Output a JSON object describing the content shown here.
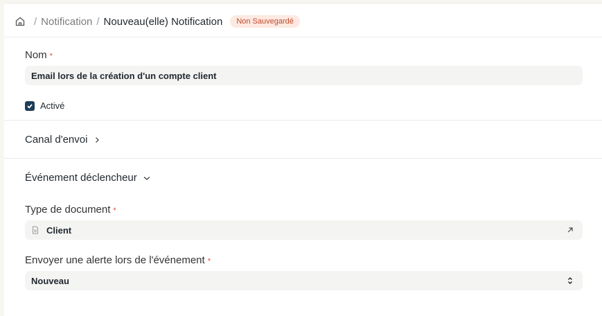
{
  "breadcrumb": {
    "home_icon": "home-icon",
    "items": [
      "Notification",
      "Nouveau(elle) Notification"
    ],
    "separator": "/",
    "status_badge": "Non Sauvegardé"
  },
  "form": {
    "nom": {
      "label": "Nom",
      "required_mark": "*",
      "value": "Email lors de la création d'un compte client"
    },
    "active": {
      "label": "Activé",
      "checked": true
    },
    "channel_section": {
      "title": "Canal d'envoi",
      "icon": "chevron-right-icon"
    },
    "trigger_section": {
      "title": "Événement déclencheur",
      "icon": "chevron-down-icon"
    },
    "document_type": {
      "label": "Type de document",
      "required_mark": "*",
      "value": "Client",
      "icon": "document-icon",
      "link_icon": "arrow-up-right-icon"
    },
    "send_alert_on": {
      "label": "Envoyer une alerte lors de l'événement",
      "required_mark": "*",
      "value": "Nouveau",
      "icon": "select-chevrons-icon"
    }
  },
  "colors": {
    "accent": "#1f3d57",
    "required": "#e0483e",
    "badge_text": "#c04a2c",
    "badge_bg": "#fde9e1"
  }
}
